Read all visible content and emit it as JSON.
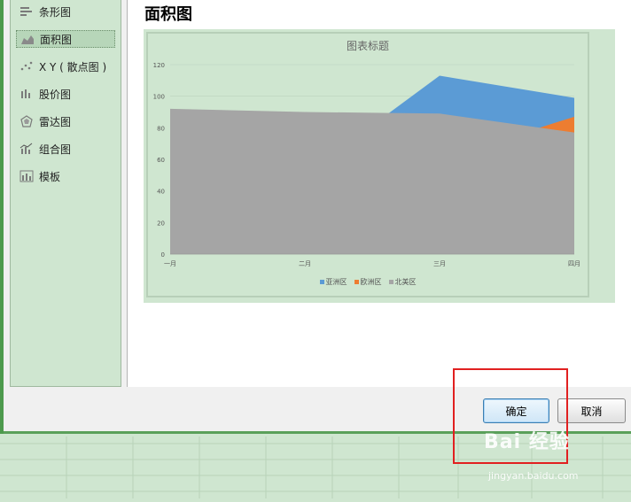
{
  "sidebar": {
    "items": [
      {
        "label": "条形图",
        "icon": "bar-chart-icon",
        "selected": false
      },
      {
        "label": "面积图",
        "icon": "area-chart-icon",
        "selected": true
      },
      {
        "label": "X Y ( 散点图 )",
        "icon": "scatter-chart-icon",
        "selected": false
      },
      {
        "label": "股价图",
        "icon": "stock-chart-icon",
        "selected": false
      },
      {
        "label": "雷达图",
        "icon": "radar-chart-icon",
        "selected": false
      },
      {
        "label": "组合图",
        "icon": "combo-chart-icon",
        "selected": false
      },
      {
        "label": "模板",
        "icon": "template-icon",
        "selected": false
      }
    ]
  },
  "main": {
    "title": "面积图"
  },
  "buttons": {
    "ok": "确定",
    "cancel": "取消"
  },
  "watermark": {
    "logo": "Bai 经验",
    "url": "jingyan.baidu.com"
  },
  "chart_data": {
    "type": "area",
    "title": "图表标题",
    "categories": [
      "一月",
      "二月",
      "三月",
      "四月"
    ],
    "ylim": [
      0,
      120
    ],
    "yticks": [
      0,
      20,
      40,
      60,
      80,
      100,
      120
    ],
    "series": [
      {
        "name": "亚洲区",
        "values": [
          54,
          50,
          113,
          99
        ],
        "color": "#5b9bd5"
      },
      {
        "name": "欧洲区",
        "values": [
          50,
          45,
          60,
          87
        ],
        "color": "#ed7d31"
      },
      {
        "name": "北美区",
        "values": [
          92,
          90,
          89,
          77
        ],
        "color": "#a5a5a5"
      }
    ],
    "legend": "bottom",
    "grid": true
  }
}
